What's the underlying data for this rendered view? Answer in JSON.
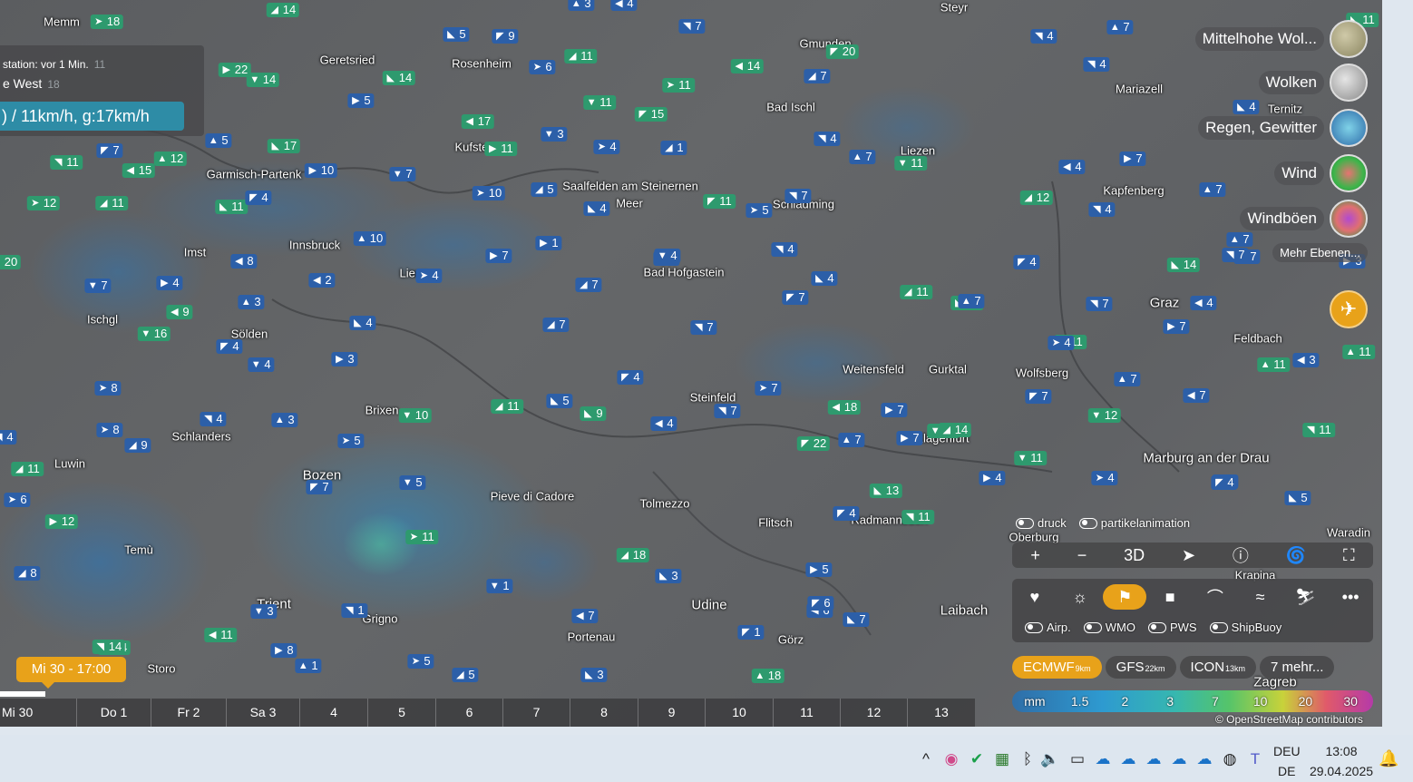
{
  "info": {
    "station_line": "station: vor 1 Min.",
    "station_gust": "11",
    "direction": "e West",
    "direction_value": "18",
    "speed": ") / 11km/h, g:17km/h"
  },
  "cities": [
    {
      "name": "Memm"
    },
    {
      "name": "Geretsried"
    },
    {
      "name": "Rosenheim"
    },
    {
      "name": "Gmunden"
    },
    {
      "name": "Steyr"
    },
    {
      "name": "Bad Ischl"
    },
    {
      "name": "Mariazell"
    },
    {
      "name": "Ternitz"
    },
    {
      "name": "Liezen"
    },
    {
      "name": "Garmisch-Partenk"
    },
    {
      "name": "Saalfelden am Steinernen"
    },
    {
      "name": "Meer"
    },
    {
      "name": "Schladming"
    },
    {
      "name": "Kapfenberg"
    },
    {
      "name": "Imst"
    },
    {
      "name": "Bad Hofgastein"
    },
    {
      "name": "Graz"
    },
    {
      "name": "Feldbach"
    },
    {
      "name": "Ischgl"
    },
    {
      "name": "Sölden"
    },
    {
      "name": "Weitensfeld"
    },
    {
      "name": "Gurktal"
    },
    {
      "name": "Wolfsberg"
    },
    {
      "name": "Steinfeld"
    },
    {
      "name": "Brixen"
    },
    {
      "name": "Schlanders"
    },
    {
      "name": "Luwin"
    },
    {
      "name": "Marburg an der Drau"
    },
    {
      "name": "Bozen"
    },
    {
      "name": "Pieve di Cadore"
    },
    {
      "name": "Tolmezzo"
    },
    {
      "name": "Flitsch"
    },
    {
      "name": "Oberburg"
    },
    {
      "name": "Temù"
    },
    {
      "name": "Udine"
    },
    {
      "name": "Trient"
    },
    {
      "name": "Grigno"
    },
    {
      "name": "Portenau"
    },
    {
      "name": "Görz"
    },
    {
      "name": "Laibach"
    },
    {
      "name": "Storo"
    },
    {
      "name": "Zagreb"
    },
    {
      "name": "Krapina"
    },
    {
      "name": "Waradin"
    },
    {
      "name": "Kufstein"
    },
    {
      "name": "Innsbruck"
    },
    {
      "name": "Lienz"
    },
    {
      "name": "Klagenfurt"
    },
    {
      "name": "Radmannsdorf"
    }
  ],
  "winds": [
    {
      "v": "18",
      "c": "g"
    },
    {
      "v": "14",
      "c": "g"
    },
    {
      "v": "5",
      "c": "b"
    },
    {
      "v": "9",
      "c": "b"
    },
    {
      "v": "7",
      "c": "b"
    },
    {
      "v": "3",
      "c": "b"
    },
    {
      "v": "4",
      "c": "b"
    },
    {
      "v": "22",
      "c": "g"
    },
    {
      "v": "14",
      "c": "g"
    },
    {
      "v": "6",
      "c": "b"
    },
    {
      "v": "11",
      "c": "g"
    },
    {
      "v": "14",
      "c": "g"
    },
    {
      "v": "20",
      "c": "g"
    },
    {
      "v": "4",
      "c": "b"
    },
    {
      "v": "7",
      "c": "b"
    },
    {
      "v": "14",
      "c": "g"
    },
    {
      "v": "5",
      "c": "b"
    },
    {
      "v": "11",
      "c": "g"
    },
    {
      "v": "11",
      "c": "g"
    },
    {
      "v": "7",
      "c": "b"
    },
    {
      "v": "17",
      "c": "g"
    },
    {
      "v": "15",
      "c": "g"
    },
    {
      "v": "4",
      "c": "b"
    },
    {
      "v": "5",
      "c": "b"
    },
    {
      "v": "17",
      "c": "g"
    },
    {
      "v": "11",
      "c": "g"
    },
    {
      "v": "3",
      "c": "b"
    },
    {
      "v": "4",
      "c": "b"
    },
    {
      "v": "1",
      "c": "b"
    },
    {
      "v": "4",
      "c": "b"
    },
    {
      "v": "7",
      "c": "b"
    },
    {
      "v": "11",
      "c": "g"
    },
    {
      "v": "12",
      "c": "g"
    },
    {
      "v": "15",
      "c": "g"
    },
    {
      "v": "10",
      "c": "b"
    },
    {
      "v": "7",
      "c": "b"
    },
    {
      "v": "10",
      "c": "b"
    },
    {
      "v": "5",
      "c": "b"
    },
    {
      "v": "4",
      "c": "b"
    },
    {
      "v": "11",
      "c": "g"
    },
    {
      "v": "4",
      "c": "b"
    },
    {
      "v": "7",
      "c": "b"
    },
    {
      "v": "4",
      "c": "b"
    },
    {
      "v": "7",
      "c": "b"
    },
    {
      "v": "11",
      "c": "g"
    },
    {
      "v": "12",
      "c": "g"
    },
    {
      "v": "11",
      "c": "g"
    },
    {
      "v": "11",
      "c": "g"
    },
    {
      "v": "4",
      "c": "b"
    },
    {
      "v": "7",
      "c": "b"
    },
    {
      "v": "10",
      "c": "b"
    },
    {
      "v": "8",
      "c": "b"
    },
    {
      "v": "1",
      "c": "b"
    },
    {
      "v": "7",
      "c": "b"
    },
    {
      "v": "5",
      "c": "b"
    },
    {
      "v": "12",
      "c": "g"
    },
    {
      "v": "14",
      "c": "g"
    },
    {
      "v": "20",
      "c": "g"
    },
    {
      "v": "4",
      "c": "b"
    },
    {
      "v": "7",
      "c": "b"
    },
    {
      "v": "2",
      "c": "b"
    },
    {
      "v": "4",
      "c": "b"
    },
    {
      "v": "7",
      "c": "b"
    },
    {
      "v": "4",
      "c": "b"
    },
    {
      "v": "11",
      "c": "g"
    },
    {
      "v": "11",
      "c": "g"
    },
    {
      "v": "7",
      "c": "b"
    },
    {
      "v": "4",
      "c": "b"
    },
    {
      "v": "3",
      "c": "b"
    },
    {
      "v": "9",
      "c": "g"
    },
    {
      "v": "7",
      "c": "b"
    },
    {
      "v": "16",
      "c": "g"
    },
    {
      "v": "14",
      "c": "g"
    },
    {
      "v": "7",
      "c": "b"
    },
    {
      "v": "4",
      "c": "b"
    },
    {
      "v": "4",
      "c": "b"
    },
    {
      "v": "7",
      "c": "b"
    },
    {
      "v": "11",
      "c": "g"
    },
    {
      "v": "4",
      "c": "b"
    },
    {
      "v": "3",
      "c": "b"
    },
    {
      "v": "4",
      "c": "b"
    },
    {
      "v": "8",
      "c": "b"
    },
    {
      "v": "7",
      "c": "b"
    },
    {
      "v": "4",
      "c": "b"
    },
    {
      "v": "4",
      "c": "b"
    },
    {
      "v": "7",
      "c": "b"
    },
    {
      "v": "11",
      "c": "g"
    },
    {
      "v": "3",
      "c": "b"
    },
    {
      "v": "7",
      "c": "b"
    },
    {
      "v": "10",
      "c": "g"
    },
    {
      "v": "5",
      "c": "b"
    },
    {
      "v": "11",
      "c": "g"
    },
    {
      "v": "9",
      "c": "g"
    },
    {
      "v": "4",
      "c": "b"
    },
    {
      "v": "4",
      "c": "b"
    },
    {
      "v": "7",
      "c": "b"
    },
    {
      "v": "18",
      "c": "g"
    },
    {
      "v": "7",
      "c": "b"
    },
    {
      "v": "11",
      "c": "g"
    },
    {
      "v": "8",
      "c": "b"
    },
    {
      "v": "9",
      "c": "b"
    },
    {
      "v": "5",
      "c": "b"
    },
    {
      "v": "22",
      "c": "g"
    },
    {
      "v": "7",
      "c": "b"
    },
    {
      "v": "7",
      "c": "b"
    },
    {
      "v": "4",
      "c": "b"
    },
    {
      "v": "7",
      "c": "b"
    },
    {
      "v": "4",
      "c": "b"
    },
    {
      "v": "7",
      "c": "b"
    },
    {
      "v": "11",
      "c": "g"
    },
    {
      "v": "13",
      "c": "g"
    },
    {
      "v": "4",
      "c": "b"
    },
    {
      "v": "11",
      "c": "g"
    },
    {
      "v": "3",
      "c": "b"
    },
    {
      "v": "6",
      "c": "b"
    },
    {
      "v": "12",
      "c": "g"
    },
    {
      "v": "5",
      "c": "b"
    },
    {
      "v": "11",
      "c": "g"
    },
    {
      "v": "18",
      "c": "g"
    },
    {
      "v": "3",
      "c": "b"
    },
    {
      "v": "6",
      "c": "b"
    },
    {
      "v": "1",
      "c": "b"
    },
    {
      "v": "1",
      "c": "b"
    },
    {
      "v": "7",
      "c": "b"
    },
    {
      "v": "5",
      "c": "b"
    },
    {
      "v": "3",
      "c": "b"
    },
    {
      "v": "6",
      "c": "b"
    },
    {
      "v": "8",
      "c": "b"
    },
    {
      "v": "7",
      "c": "b"
    },
    {
      "v": "1",
      "c": "b"
    },
    {
      "v": "14",
      "c": "g"
    },
    {
      "v": "18",
      "c": "g"
    },
    {
      "v": "11",
      "c": "g"
    },
    {
      "v": "8",
      "c": "b"
    },
    {
      "v": "1",
      "c": "b"
    },
    {
      "v": "5",
      "c": "b"
    },
    {
      "v": "5",
      "c": "b"
    },
    {
      "v": "3",
      "c": "b"
    },
    {
      "v": "7",
      "c": "b"
    },
    {
      "v": "4",
      "c": "b"
    },
    {
      "v": "7",
      "c": "b"
    },
    {
      "v": "7",
      "c": "b"
    },
    {
      "v": "4",
      "c": "b"
    },
    {
      "v": "11",
      "c": "g"
    },
    {
      "v": "4",
      "c": "b"
    },
    {
      "v": "7",
      "c": "b"
    },
    {
      "v": "5",
      "c": "b"
    },
    {
      "v": "7",
      "c": "b"
    },
    {
      "v": "11",
      "c": "g"
    },
    {
      "v": "11",
      "c": "g"
    },
    {
      "v": "7",
      "c": "b"
    },
    {
      "v": "3",
      "c": "b"
    },
    {
      "v": "12",
      "c": "g"
    },
    {
      "v": "4",
      "c": "b"
    },
    {
      "v": "14",
      "c": "g"
    },
    {
      "v": "11",
      "c": "g"
    },
    {
      "v": "4",
      "c": "b"
    },
    {
      "v": "7",
      "c": "b"
    },
    {
      "v": "7",
      "c": "b"
    }
  ],
  "layers": [
    {
      "label": "Mittelhohe Wol...",
      "icon": "clouds-mid-icon"
    },
    {
      "label": "Wolken",
      "icon": "clouds-icon"
    },
    {
      "label": "Regen, Gewitter",
      "icon": "rain-icon"
    },
    {
      "label": "Wind",
      "icon": "wind-icon"
    },
    {
      "label": "Windböen",
      "icon": "gust-icon"
    },
    {
      "label": "Mehr Ebenen..."
    }
  ],
  "toggles1": [
    "druck",
    "partikelanimation"
  ],
  "controls": {
    "three_d": "3D"
  },
  "toggles2": [
    "Airp.",
    "WMO",
    "PWS",
    "ShipBuoy"
  ],
  "models": [
    {
      "name": "ECMWF",
      "res": "9km"
    },
    {
      "name": "GFS",
      "res": "22km"
    },
    {
      "name": "ICON",
      "res": "13km"
    },
    {
      "name": "7 mehr..."
    }
  ],
  "legend": [
    "mm",
    "1.5",
    "2",
    "3",
    "7",
    "10",
    "20",
    "30"
  ],
  "attribution": "© OpenStreetMap contributors",
  "timeline": {
    "current": "Mi 30 - 17:00",
    "days": [
      "Mi 30",
      "Do 1",
      "Fr 2",
      "Sa 3",
      "4",
      "5",
      "6",
      "7",
      "8",
      "9",
      "10",
      "11",
      "12",
      "13"
    ]
  },
  "taskbar": {
    "lang1": "DEU",
    "lang2": "DE",
    "time": "13:08",
    "date": "29.04.2025",
    "tray_icons": [
      "chevron-up-icon",
      "color-icon",
      "shield-icon",
      "app-icon",
      "bluetooth-icon",
      "volume-icon",
      "display-icon",
      "cloud-icon",
      "cloud-icon",
      "cloud-icon",
      "cloud-icon",
      "cloud-icon",
      "compass-icon",
      "teams-icon"
    ]
  },
  "colors": {
    "accent": "#e8a21a",
    "wind_blue": "#2c5fa8",
    "wind_green": "#2e9a6e",
    "pill": "#2e8ca6"
  }
}
